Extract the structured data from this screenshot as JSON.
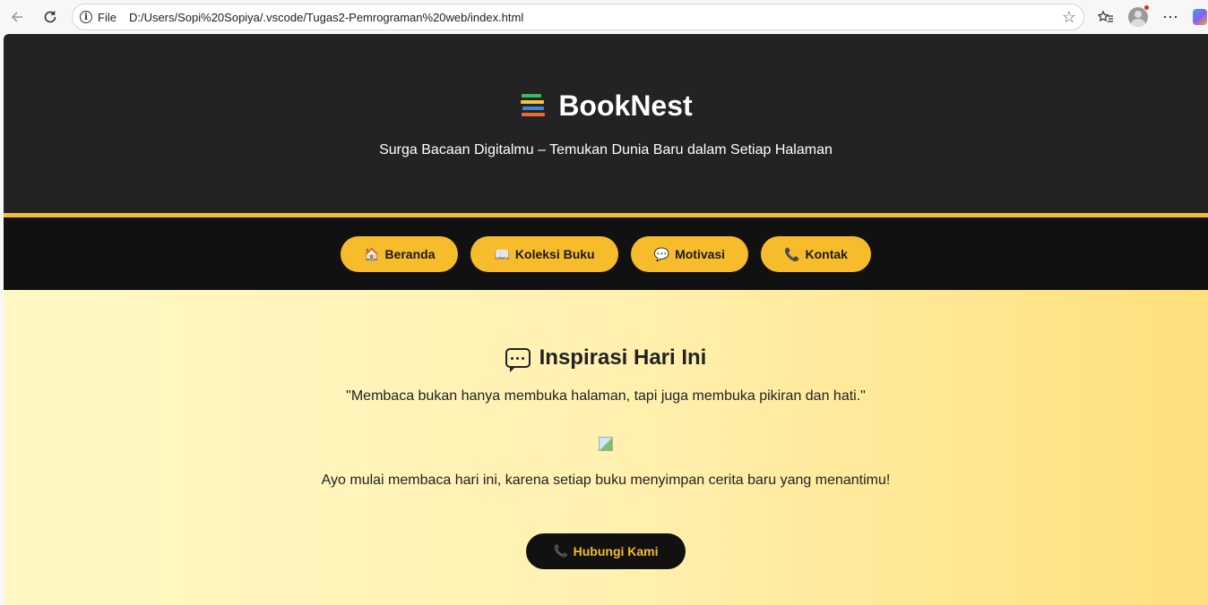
{
  "browser": {
    "file_label": "File",
    "url": "D:/Users/Sopi%20Sopiya/.vscode/Tugas2-Pemrograman%20web/index.html",
    "back_icon": "back-arrow-icon",
    "refresh_icon": "refresh-icon",
    "favorite_icon": "star-icon"
  },
  "header": {
    "title": "BookNest",
    "subtitle": "Surga Bacaan Digitalmu – Temukan Dunia Baru dalam Setiap Halaman"
  },
  "nav": {
    "items": [
      {
        "icon": "🏠",
        "label": "Beranda"
      },
      {
        "icon": "📖",
        "label": "Koleksi Buku"
      },
      {
        "icon": "💬",
        "label": "Motivasi"
      },
      {
        "icon": "📞",
        "label": "Kontak"
      }
    ]
  },
  "hero": {
    "heading": "Inspirasi Hari Ini",
    "quote": "\"Membaca bukan hanya membuka halaman, tapi juga membuka pikiran dan hati.\"",
    "cta_text": "Ayo mulai membaca hari ini, karena setiap buku menyimpan cerita baru yang menantimu!",
    "cta_button": "Hubungi Kami",
    "cta_icon": "📞"
  },
  "colors": {
    "accent": "#f6bc2b",
    "header_bg": "#232325",
    "nav_bg": "#111111"
  }
}
